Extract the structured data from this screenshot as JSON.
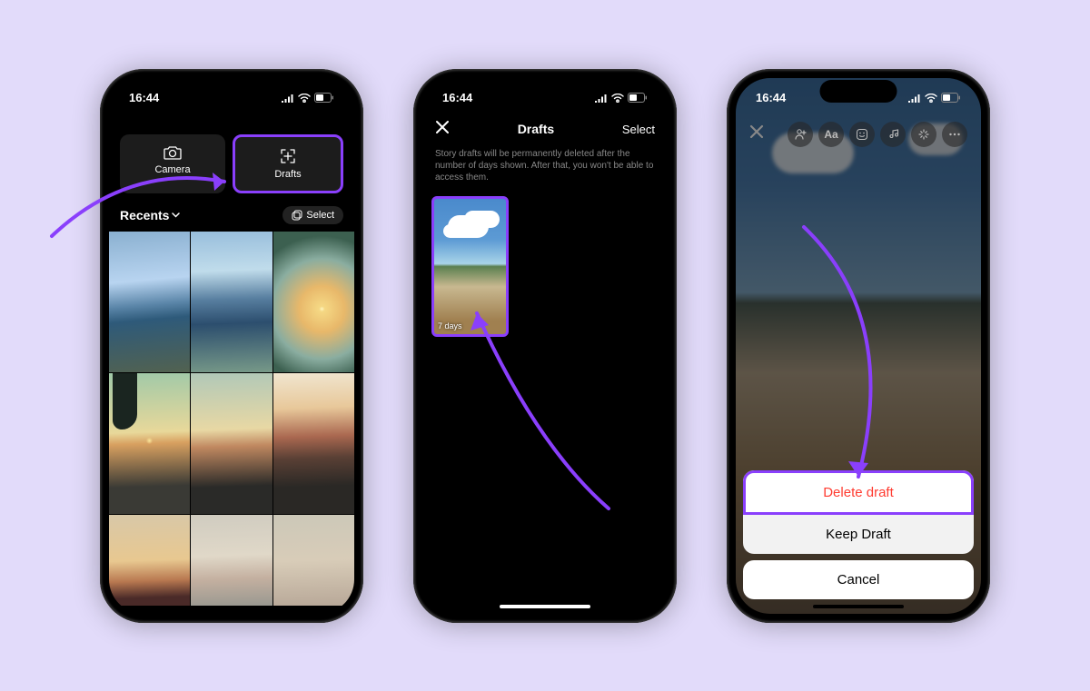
{
  "status": {
    "time": "16:44"
  },
  "phone1": {
    "camera_label": "Camera",
    "drafts_label": "Drafts",
    "recents_label": "Recents",
    "select_label": "Select"
  },
  "phone2": {
    "title": "Drafts",
    "select_label": "Select",
    "description": "Story drafts will be permanently deleted after the number of days shown. After that, you won't be able to access them.",
    "draft_badge": "7 days"
  },
  "phone3": {
    "delete_label": "Delete draft",
    "keep_label": "Keep Draft",
    "cancel_label": "Cancel"
  }
}
